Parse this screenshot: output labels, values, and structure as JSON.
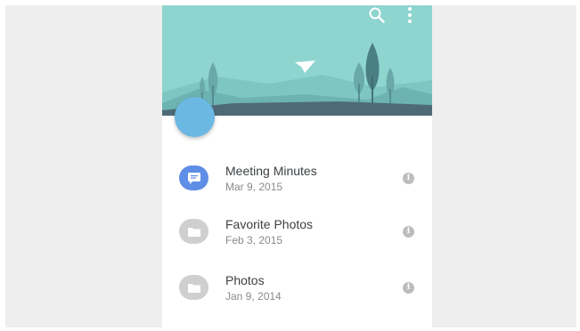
{
  "header": {
    "actions": [
      {
        "name": "search-icon"
      },
      {
        "name": "more-vert-icon"
      }
    ],
    "colors": {
      "sky": "#8fd5cf",
      "hill_light": "#7ec6c2",
      "hill_dark": "#6db3b3",
      "ground": "#4e6a78",
      "tree_light": "#6aa9a9",
      "tree_dark": "#4a7f86",
      "plane": "#ffffff"
    }
  },
  "fab": {
    "color": "#6bb8e2"
  },
  "files": [
    {
      "title": "Meeting Minutes",
      "date": "Mar 9, 2015",
      "icon": "message-icon",
      "icon_color": "#5e8ee6"
    },
    {
      "title": "Favorite Photos",
      "date": "Feb 3, 2015",
      "icon": "folder-icon",
      "icon_color": "#cfcfcf"
    },
    {
      "title": "Photos",
      "date": "Jan 9, 2014",
      "icon": "folder-icon",
      "icon_color": "#cfcfcf"
    }
  ]
}
